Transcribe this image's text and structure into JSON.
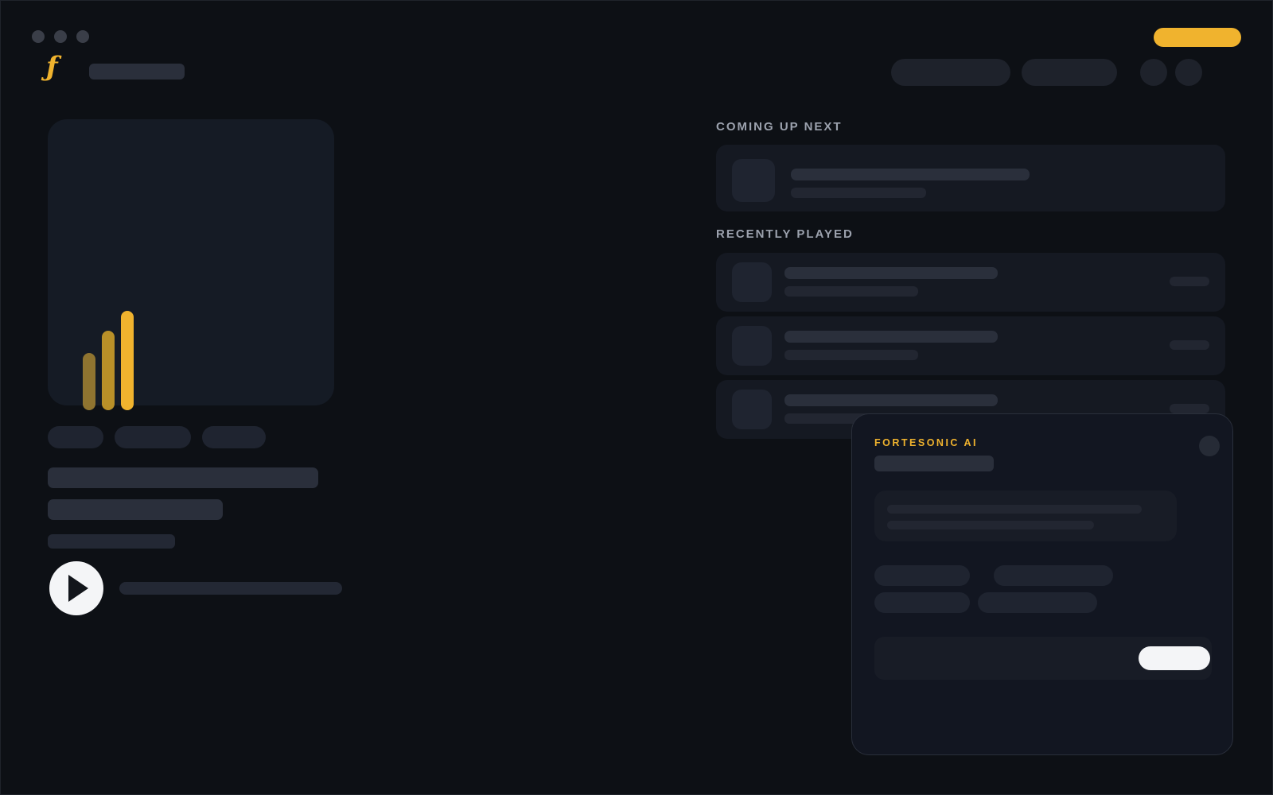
{
  "window": {
    "controls": [
      "close",
      "minimize",
      "maximize"
    ]
  },
  "brand": {
    "logo_glyph": "ƒ",
    "accent_color": "#f0b32e"
  },
  "icons": {
    "logo": "fortesonic-f-logo",
    "play": "play-icon",
    "visualizer": "equalizer-bars-icon",
    "close": "close-icon"
  },
  "visualizer": {
    "levels": [
      0.55,
      0.78,
      1.0
    ]
  },
  "sections": {
    "coming_up_next": "COMING UP NEXT",
    "recently_played": "RECENTLY PLAYED"
  },
  "assistant": {
    "label": "FORTESONIC AI"
  },
  "colors": {
    "background": "#0d1015",
    "surface": "#151922",
    "accent": "#f0b32e",
    "play_button": "#f4f5f7"
  }
}
